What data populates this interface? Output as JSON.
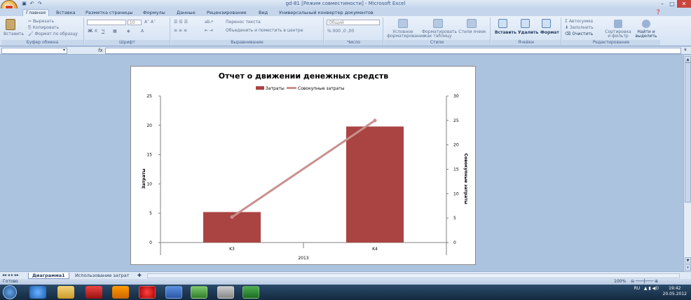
{
  "window": {
    "title": "gd-81  [Режим совместимости] - Microsoft Excel"
  },
  "tabs": [
    "Главная",
    "Вставка",
    "Разметка страницы",
    "Формулы",
    "Данные",
    "Рецензирование",
    "Вид",
    "Универсальный конвертер документов"
  ],
  "ribbon": {
    "clipboard": {
      "paste": "Вставить",
      "cut": "Вырезать",
      "copy": "Копировать",
      "format_painter": "Формат по образцу",
      "label": "Буфер обмена"
    },
    "font": {
      "size": "10",
      "bold": "Ж",
      "italic": "К",
      "underline": "Ч",
      "label": "Шрифт"
    },
    "alignment": {
      "wrap": "Перенос текста",
      "merge": "Объединить и поместить в центре",
      "label": "Выравнивание"
    },
    "number": {
      "format": "Общий",
      "label": "Число"
    },
    "styles": {
      "conditional": "Условное форматирование",
      "format_table": "Форматировать как таблицу",
      "cell_styles": "Стили ячеек",
      "label": "Стили"
    },
    "cells": {
      "insert": "Вставить",
      "delete": "Удалить",
      "format": "Формат",
      "label": "Ячейки"
    },
    "editing": {
      "autosum": "Автосумма",
      "fill": "Заполнить",
      "clear": "Очистить",
      "sort": "Сортировка и фильтр",
      "find": "Найти и выделить",
      "label": "Редактирование"
    }
  },
  "formula_bar": {
    "fx": "fx",
    "name_box": "",
    "value": ""
  },
  "chart_data": {
    "type": "bar",
    "title": "Отчет о движении денежных средств",
    "categories": [
      "K3",
      "K4"
    ],
    "group_label": "2013",
    "series": [
      {
        "name": "Затраты",
        "type": "bar",
        "axis": "left",
        "values": [
          5.2,
          19.8
        ],
        "color": "#a94442"
      },
      {
        "name": "Совокупные затраты",
        "type": "line",
        "axis": "right",
        "values": [
          5.2,
          25
        ],
        "color": "#c9908e"
      }
    ],
    "ylabel": "Затраты",
    "y2label": "Совокупные затраты",
    "ylim": [
      0,
      25
    ],
    "yticks": [
      "0",
      "5",
      "10",
      "15",
      "20",
      "25"
    ],
    "y2lim": [
      0,
      30
    ],
    "y2ticks": [
      "0",
      "5",
      "10",
      "15",
      "20",
      "25",
      "30"
    ],
    "legend_position": "top"
  },
  "sheet_tabs": [
    "Диаграмма1",
    "Использование затрат"
  ],
  "status": {
    "ready": "Готово",
    "zoom": "100%"
  },
  "tray": {
    "lang": "RU",
    "time": "19:42",
    "date": "20.05.2012"
  }
}
